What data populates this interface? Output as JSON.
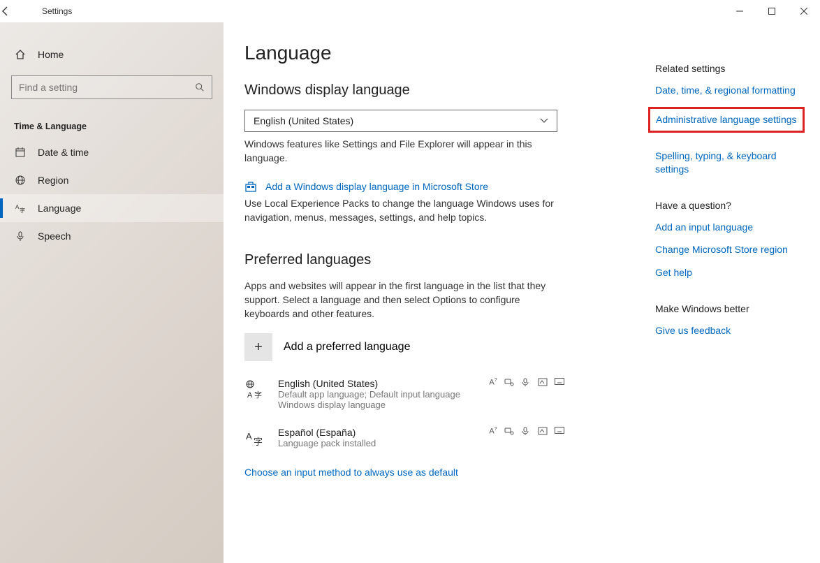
{
  "titlebar": {
    "title": "Settings"
  },
  "sidebar": {
    "home": "Home",
    "search_placeholder": "Find a setting",
    "section": "Time & Language",
    "items": [
      {
        "label": "Date & time"
      },
      {
        "label": "Region"
      },
      {
        "label": "Language"
      },
      {
        "label": "Speech"
      }
    ]
  },
  "page": {
    "title": "Language",
    "display_heading": "Windows display language",
    "display_value": "English (United States)",
    "display_desc": "Windows features like Settings and File Explorer will appear in this language.",
    "add_display_link": "Add a Windows display language in Microsoft Store",
    "add_display_desc": "Use Local Experience Packs to change the language Windows uses for navigation, menus, messages, settings, and help topics.",
    "preferred_heading": "Preferred languages",
    "preferred_desc": "Apps and websites will appear in the first language in the list that they support. Select a language and then select Options to configure keyboards and other features.",
    "add_preferred": "Add a preferred language",
    "langs": [
      {
        "name": "English (United States)",
        "sub1": "Default app language; Default input language",
        "sub2": "Windows display language"
      },
      {
        "name": "Español (España)",
        "sub1": "Language pack installed",
        "sub2": ""
      }
    ],
    "choose_link": "Choose an input method to always use as default"
  },
  "right": {
    "h1": "Related settings",
    "l1": "Date, time, & regional formatting",
    "l2": "Administrative language settings",
    "l3": "Spelling, typing, & keyboard settings",
    "h2": "Have a question?",
    "l4": "Add an input language",
    "l5": "Change Microsoft Store region",
    "l6": "Get help",
    "h3": "Make Windows better",
    "l7": "Give us feedback"
  }
}
